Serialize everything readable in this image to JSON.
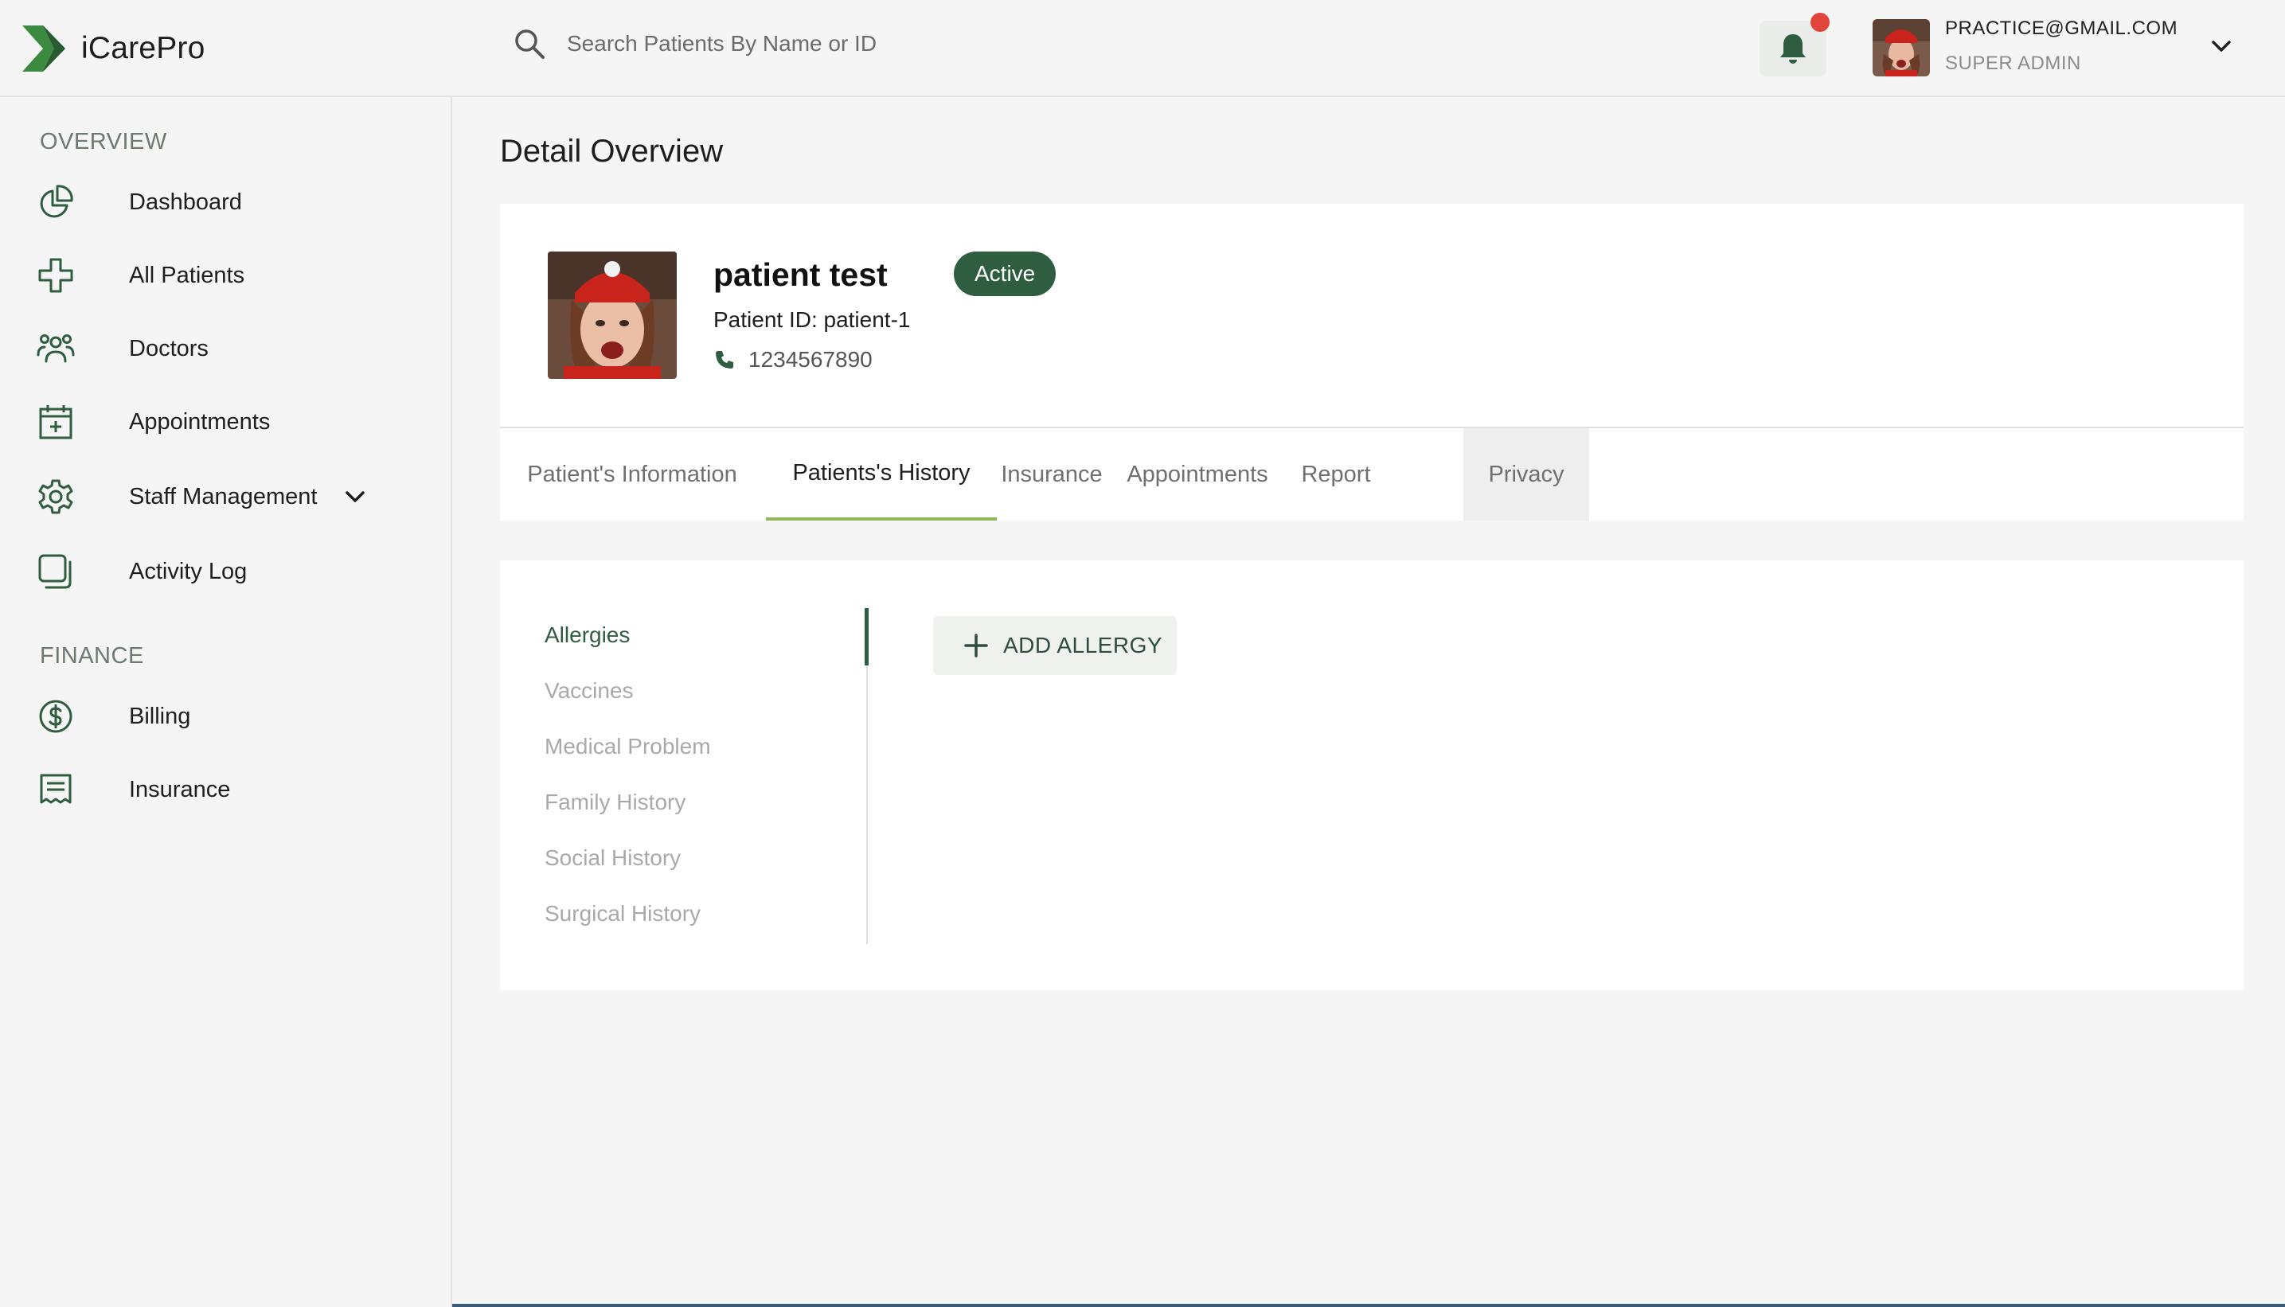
{
  "app": {
    "name": "iCarePro"
  },
  "search": {
    "placeholder": "Search Patients By Name or ID"
  },
  "user": {
    "email": "PRACTICE@GMAIL.COM",
    "role": "SUPER ADMIN"
  },
  "sidebar": {
    "sections": [
      {
        "title": "OVERVIEW"
      },
      {
        "title": "FINANCE"
      }
    ],
    "items": [
      {
        "label": "Dashboard",
        "icon": "pie-chart-icon"
      },
      {
        "label": "All Patients",
        "icon": "medical-cross-icon"
      },
      {
        "label": "Doctors",
        "icon": "users-icon"
      },
      {
        "label": "Appointments",
        "icon": "calendar-plus-icon"
      },
      {
        "label": "Staff Management",
        "icon": "gear-icon"
      },
      {
        "label": "Activity Log",
        "icon": "stacked-squares-icon"
      },
      {
        "label": "Billing",
        "icon": "dollar-circle-icon"
      },
      {
        "label": "Insurance",
        "icon": "receipt-icon"
      }
    ]
  },
  "page": {
    "title": "Detail Overview"
  },
  "patient": {
    "name": "patient test",
    "status": "Active",
    "id_text": "Patient ID: patient-1",
    "phone": "1234567890"
  },
  "tabs": [
    {
      "label": "Patient's Information"
    },
    {
      "label": "Patients's History",
      "active": true
    },
    {
      "label": "Insurance"
    },
    {
      "label": "Appointments"
    },
    {
      "label": "Report"
    },
    {
      "label": "Privacy"
    }
  ],
  "history": {
    "items": [
      {
        "label": "Allergies",
        "active": true
      },
      {
        "label": "Vaccines"
      },
      {
        "label": "Medical Problem"
      },
      {
        "label": "Family History"
      },
      {
        "label": "Social History"
      },
      {
        "label": "Surgical History"
      }
    ],
    "add_button": "ADD ALLERGY"
  },
  "colors": {
    "brand_green": "#2f5d40",
    "tab_underline": "#8fb65a",
    "notification_dot": "#e0443a"
  }
}
